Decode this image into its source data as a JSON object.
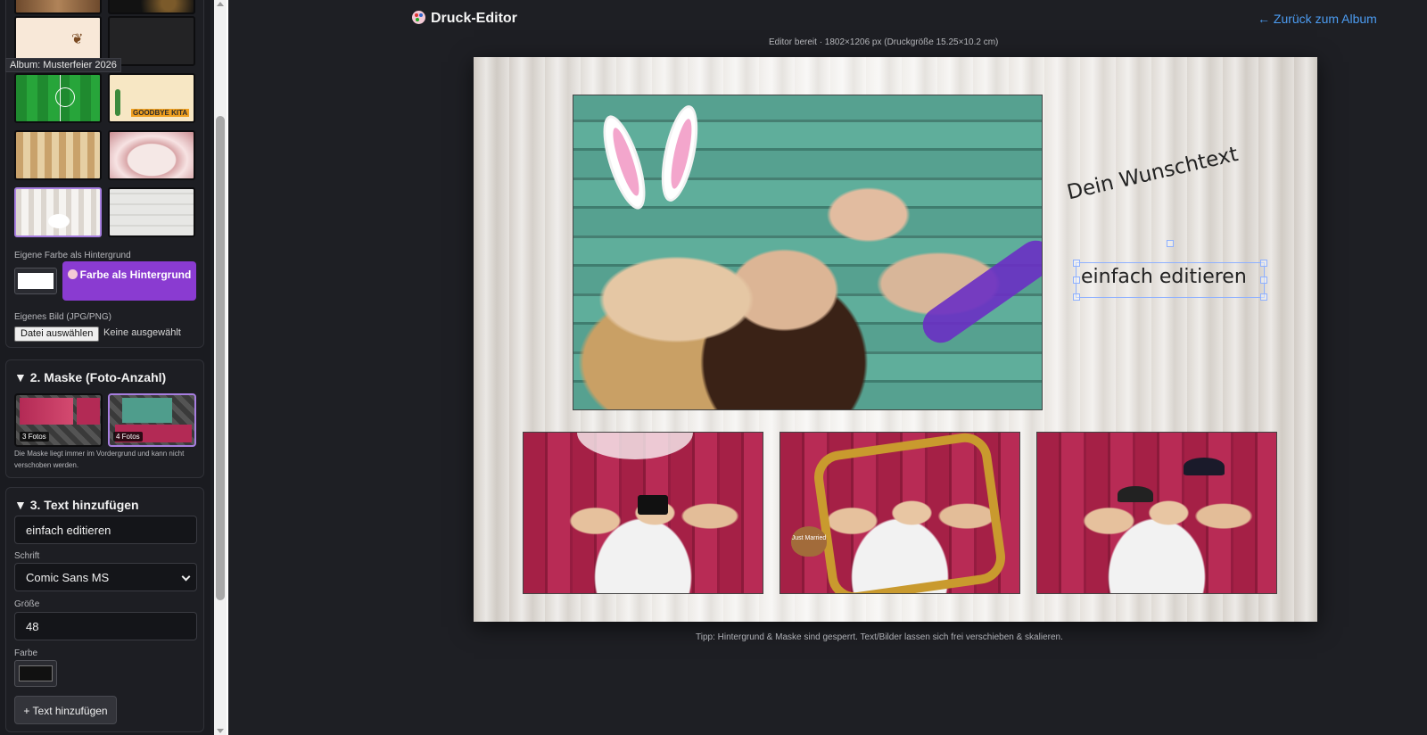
{
  "sidebar": {
    "album_tooltip": "Album: Musterfeier 2026",
    "background": {
      "thumbnails": [
        {
          "name": "wood-curtain",
          "selected": false
        },
        {
          "name": "dark-lights",
          "selected": false
        },
        {
          "name": "cream-floral",
          "selected": false
        },
        {
          "name": "dark-texture",
          "selected": false
        },
        {
          "name": "soccer-field",
          "selected": false
        },
        {
          "name": "goodbye-kita",
          "selected": false,
          "text": "GOODBYE KITA"
        },
        {
          "name": "gold-curtains",
          "selected": false
        },
        {
          "name": "flower-arch",
          "selected": false
        },
        {
          "name": "white-curtain",
          "selected": true
        },
        {
          "name": "white-wood",
          "selected": false
        }
      ],
      "own_color_label": "Eigene Farbe als Hintergrund",
      "own_color_value": "#ffffff",
      "color_button_label": "Farbe als Hintergrund",
      "own_image_label": "Eigenes Bild (JPG/PNG)",
      "file_button_label": "Datei auswählen",
      "file_none_label": "Keine ausgewählt"
    },
    "mask": {
      "heading": "▼ 2. Maske (Foto-Anzahl)",
      "options": [
        {
          "label": "3 Fotos",
          "selected": false
        },
        {
          "label": "4 Fotos",
          "selected": true
        }
      ],
      "hint": "Die Maske liegt immer im Vordergrund und kann nicht verschoben werden."
    },
    "text": {
      "heading": "▼ 3. Text hinzufügen",
      "text_value": "einfach editieren",
      "font_label": "Schrift",
      "font_value": "Comic Sans MS",
      "size_label": "Größe",
      "size_value": "48",
      "color_label": "Farbe",
      "color_value": "#111111",
      "add_button_label": "+ Text hinzufügen"
    }
  },
  "header": {
    "title": "Druck-Editor",
    "back_link": "← Zurück zum Album",
    "status": "Editor bereit · 1802×1206 px (Druckgröße 15.25×10.2 cm)"
  },
  "canvas": {
    "text_1": "Dein Wunschtext",
    "text_2": "einfach editieren",
    "small_photo_2_prop": "Just Married"
  },
  "footer": {
    "tip": "Tipp: Hintergrund & Maske sind gesperrt. Text/Bilder lassen sich frei verschieben & skalieren."
  },
  "colors": {
    "accent_purple": "#8a3bd1",
    "selection_border": "#a77ee0",
    "link_blue": "#4c9cf2",
    "app_bg": "#1e1f24"
  }
}
